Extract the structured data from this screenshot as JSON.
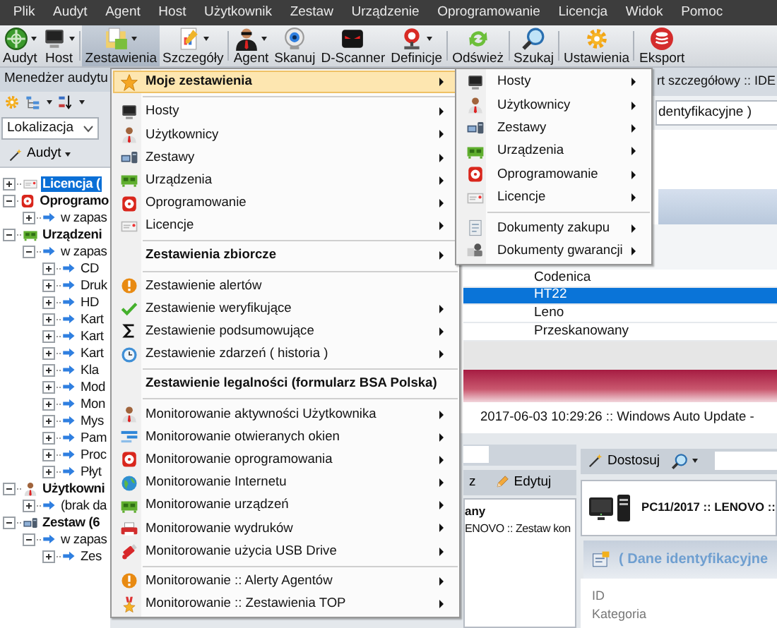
{
  "menu_bar": [
    "Plik",
    "Audyt",
    "Agent",
    "Host",
    "Użytkownik",
    "Zestaw",
    "Urządzenie",
    "Oprogramowanie",
    "Licencja",
    "Widok",
    "Pomoc"
  ],
  "toolbar": [
    {
      "kind": "button",
      "label": "Audyt",
      "dropdown": true,
      "selected": false
    },
    {
      "kind": "button",
      "label": "Host",
      "dropdown": true,
      "selected": false
    },
    {
      "kind": "separator"
    },
    {
      "kind": "button",
      "label": "Zestawienia",
      "dropdown": true,
      "selected": true
    },
    {
      "kind": "button",
      "label": "Szczegóły",
      "dropdown": true,
      "selected": false
    },
    {
      "kind": "separator"
    },
    {
      "kind": "button",
      "label": "Agent",
      "dropdown": true,
      "selected": false
    },
    {
      "kind": "button",
      "label": "Skanuj",
      "dropdown": false,
      "selected": false
    },
    {
      "kind": "button",
      "label": "D-Scanner",
      "dropdown": false,
      "selected": false
    },
    {
      "kind": "button",
      "label": "Definicje",
      "dropdown": true,
      "selected": false
    },
    {
      "kind": "separator"
    },
    {
      "kind": "button",
      "label": "Odśwież",
      "dropdown": false,
      "selected": false
    },
    {
      "kind": "separator"
    },
    {
      "kind": "button",
      "label": "Szukaj",
      "dropdown": false,
      "selected": false
    },
    {
      "kind": "separator"
    },
    {
      "kind": "button",
      "label": "Ustawienia",
      "dropdown": false,
      "selected": false
    },
    {
      "kind": "separator"
    },
    {
      "kind": "button",
      "label": "Eksport",
      "dropdown": false,
      "selected": false
    }
  ],
  "left_panel": {
    "title": "Menedżer audytu",
    "location": "Lokalizacja",
    "audit_button": "Audyt",
    "tree": [
      {
        "label": "Licencja (",
        "expanded": false,
        "selected": true
      },
      {
        "label": "Oprogramo",
        "expanded": true,
        "selected": false,
        "children": [
          {
            "label": "w zapas",
            "expanded": false,
            "selected": false
          }
        ]
      },
      {
        "label": "Urządzeni",
        "expanded": true,
        "selected": false,
        "children": [
          {
            "label": "w zapas",
            "expanded": true,
            "selected": false,
            "children": [
              {
                "label": "CD",
                "expanded": false,
                "selected": false
              },
              {
                "label": "Druk",
                "expanded": false,
                "selected": false
              },
              {
                "label": "HD",
                "expanded": false,
                "selected": false
              },
              {
                "label": "Kart",
                "expanded": false,
                "selected": false
              },
              {
                "label": "Kart",
                "expanded": false,
                "selected": false
              },
              {
                "label": "Kart",
                "expanded": false,
                "selected": false
              },
              {
                "label": "Kla",
                "expanded": false,
                "selected": false
              },
              {
                "label": "Mod",
                "expanded": false,
                "selected": false
              },
              {
                "label": "Mon",
                "expanded": false,
                "selected": false
              },
              {
                "label": "Mys",
                "expanded": false,
                "selected": false
              },
              {
                "label": "Pam",
                "expanded": false,
                "selected": false
              },
              {
                "label": "Proc",
                "expanded": false,
                "selected": false
              },
              {
                "label": "Płyt",
                "expanded": false,
                "selected": false
              }
            ]
          }
        ]
      },
      {
        "label": "Użytkowni",
        "expanded": true,
        "selected": false,
        "children": [
          {
            "label": "(brak da",
            "expanded": false,
            "selected": false
          }
        ]
      },
      {
        "label": "Zestaw (6",
        "expanded": true,
        "selected": false,
        "children": [
          {
            "label": "w zapas",
            "expanded": true,
            "selected": false,
            "children": [
              {
                "label": "Zes",
                "expanded": false,
                "selected": false
              }
            ]
          }
        ]
      }
    ]
  },
  "content": {
    "tab_text": "rt szczegółowy :: IDE",
    "field_text": "dentyfikacyjne )",
    "rows": [
      {
        "text": "Codenica",
        "selected": false
      },
      {
        "text": "HT22",
        "selected": true
      },
      {
        "text": "Leno",
        "selected": false
      },
      {
        "text": "Przeskanowany",
        "selected": false
      }
    ],
    "log_line": "2017-06-03 10:29:26 :: Windows Auto Update -",
    "lower_left": {
      "partial_button": "z",
      "edit_button": "Edytuj",
      "title": "any",
      "line": "ENOVO :: Zestaw kon"
    },
    "lower_right": {
      "customize_button": "Dostosuj",
      "title": "PC11/2017 :: LENOVO ::",
      "section": "( Dane identyfikacyjne",
      "fields": [
        "ID",
        "Kategoria"
      ]
    }
  },
  "menu": {
    "items": [
      {
        "kind": "item",
        "label": "Moje zestawienia",
        "bold": true,
        "submenu": true,
        "selected": true
      },
      {
        "kind": "separator"
      },
      {
        "kind": "item",
        "label": "Hosty",
        "bold": false,
        "submenu": true,
        "selected": false
      },
      {
        "kind": "item",
        "label": "Użytkownicy",
        "bold": false,
        "submenu": true,
        "selected": false
      },
      {
        "kind": "item",
        "label": "Zestawy",
        "bold": false,
        "submenu": true,
        "selected": false
      },
      {
        "kind": "item",
        "label": "Urządzenia",
        "bold": false,
        "submenu": true,
        "selected": false
      },
      {
        "kind": "item",
        "label": "Oprogramowanie",
        "bold": false,
        "submenu": true,
        "selected": false
      },
      {
        "kind": "item",
        "label": "Licencje",
        "bold": false,
        "submenu": true,
        "selected": false
      },
      {
        "kind": "separator"
      },
      {
        "kind": "item",
        "label": "Zestawienia zbiorcze",
        "bold": true,
        "submenu": true,
        "selected": false
      },
      {
        "kind": "separator"
      },
      {
        "kind": "item",
        "label": "Zestawienie alertów",
        "bold": false,
        "submenu": false,
        "selected": false
      },
      {
        "kind": "item",
        "label": "Zestawienie weryfikujące",
        "bold": false,
        "submenu": true,
        "selected": false
      },
      {
        "kind": "item",
        "label": "Zestawienie podsumowujące",
        "bold": false,
        "submenu": true,
        "selected": false
      },
      {
        "kind": "item",
        "label": "Zestawienie zdarzeń ( historia )",
        "bold": false,
        "submenu": true,
        "selected": false
      },
      {
        "kind": "separator"
      },
      {
        "kind": "item",
        "label": "Zestawienie legalności (formularz BSA Polska)",
        "bold": true,
        "submenu": false,
        "selected": false
      },
      {
        "kind": "separator"
      },
      {
        "kind": "item",
        "label": "Monitorowanie aktywności Użytkownika",
        "bold": false,
        "submenu": true,
        "selected": false
      },
      {
        "kind": "item",
        "label": "Monitorowanie otwieranych okien",
        "bold": false,
        "submenu": true,
        "selected": false
      },
      {
        "kind": "item",
        "label": "Monitorowanie oprogramowania",
        "bold": false,
        "submenu": true,
        "selected": false
      },
      {
        "kind": "item",
        "label": "Monitorowanie Internetu",
        "bold": false,
        "submenu": true,
        "selected": false
      },
      {
        "kind": "item",
        "label": "Monitorowanie urządzeń",
        "bold": false,
        "submenu": true,
        "selected": false
      },
      {
        "kind": "item",
        "label": "Monitorowanie wydruków",
        "bold": false,
        "submenu": true,
        "selected": false
      },
      {
        "kind": "item",
        "label": "Monitorowanie użycia USB Drive",
        "bold": false,
        "submenu": true,
        "selected": false
      },
      {
        "kind": "separator"
      },
      {
        "kind": "item",
        "label": "Monitorowanie :: Alerty Agentów",
        "bold": false,
        "submenu": true,
        "selected": false
      },
      {
        "kind": "item",
        "label": "Monitorowanie :: Zestawienia TOP",
        "bold": false,
        "submenu": true,
        "selected": false
      }
    ]
  },
  "submenu": {
    "items": [
      {
        "kind": "item",
        "label": "Hosty",
        "submenu": true,
        "selected": false
      },
      {
        "kind": "item",
        "label": "Użytkownicy",
        "submenu": true,
        "selected": false
      },
      {
        "kind": "item",
        "label": "Zestawy",
        "submenu": true,
        "selected": false
      },
      {
        "kind": "item",
        "label": "Urządzenia",
        "submenu": true,
        "selected": false
      },
      {
        "kind": "item",
        "label": "Oprogramowanie",
        "submenu": true,
        "selected": false
      },
      {
        "kind": "item",
        "label": "Licencje",
        "submenu": true,
        "selected": false
      },
      {
        "kind": "separator"
      },
      {
        "kind": "item",
        "label": "Dokumenty zakupu",
        "submenu": true,
        "selected": false
      },
      {
        "kind": "item",
        "label": "Dokumenty gwarancji",
        "submenu": true,
        "selected": false
      }
    ]
  }
}
